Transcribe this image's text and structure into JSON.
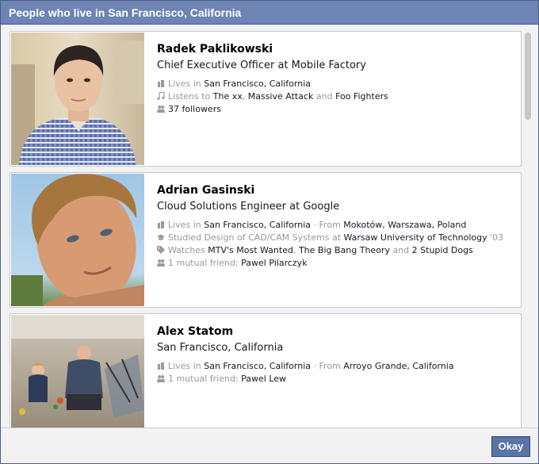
{
  "dialog": {
    "title": "People who live in San Francisco, California",
    "okay_label": "Okay"
  },
  "people": [
    {
      "name": "Radek Paklikowski",
      "subtitle": "Chief Executive Officer at Mobile Factory",
      "facts": [
        {
          "icon": "home-icon",
          "parts": [
            {
              "text": "Lives in ",
              "style": "muted"
            },
            {
              "text": "San Francisco, California",
              "style": "link"
            }
          ]
        },
        {
          "icon": "music-note-icon",
          "parts": [
            {
              "text": "Listens to ",
              "style": "muted"
            },
            {
              "text": "The xx",
              "style": "link"
            },
            {
              "text": ", ",
              "style": "muted"
            },
            {
              "text": "Massive Attack",
              "style": "link"
            },
            {
              "text": " and ",
              "style": "muted"
            },
            {
              "text": "Foo Fighters",
              "style": "link"
            }
          ]
        },
        {
          "icon": "people-icon",
          "parts": [
            {
              "text": "37 followers",
              "style": "dark"
            }
          ]
        }
      ]
    },
    {
      "name": "Adrian Gasinski",
      "subtitle": "Cloud Solutions Engineer at Google",
      "facts": [
        {
          "icon": "home-icon",
          "parts": [
            {
              "text": "Lives in ",
              "style": "muted"
            },
            {
              "text": "San Francisco, California",
              "style": "link"
            },
            {
              "text": " · From ",
              "style": "muted"
            },
            {
              "text": "Mokotów, Warszawa, Poland",
              "style": "link"
            }
          ]
        },
        {
          "icon": "graduation-cap-icon",
          "parts": [
            {
              "text": "Studied Design of CAD/CAM Systems at ",
              "style": "muted"
            },
            {
              "text": "Warsaw University of Technology",
              "style": "link"
            },
            {
              "text": " '03",
              "style": "muted"
            }
          ]
        },
        {
          "icon": "tag-icon",
          "parts": [
            {
              "text": "Watches ",
              "style": "muted"
            },
            {
              "text": "MTV's Most Wanted",
              "style": "link"
            },
            {
              "text": ", ",
              "style": "muted"
            },
            {
              "text": "The Big Bang Theory",
              "style": "link"
            },
            {
              "text": " and ",
              "style": "muted"
            },
            {
              "text": "2 Stupid Dogs",
              "style": "link"
            }
          ]
        },
        {
          "icon": "people-icon",
          "parts": [
            {
              "text": "1 mutual friend: ",
              "style": "muted"
            },
            {
              "text": "Pawel Pilarczyk",
              "style": "link"
            }
          ]
        }
      ]
    },
    {
      "name": "Alex Statom",
      "subtitle": "San Francisco, California",
      "facts": [
        {
          "icon": "home-icon",
          "parts": [
            {
              "text": "Lives in ",
              "style": "muted"
            },
            {
              "text": "San Francisco, California",
              "style": "link"
            },
            {
              "text": " · From ",
              "style": "muted"
            },
            {
              "text": "Arroyo Grande, California",
              "style": "link"
            }
          ]
        },
        {
          "icon": "people-icon",
          "parts": [
            {
              "text": "1 mutual friend: ",
              "style": "muted"
            },
            {
              "text": "Pawel Lew",
              "style": "link"
            }
          ]
        }
      ]
    }
  ]
}
